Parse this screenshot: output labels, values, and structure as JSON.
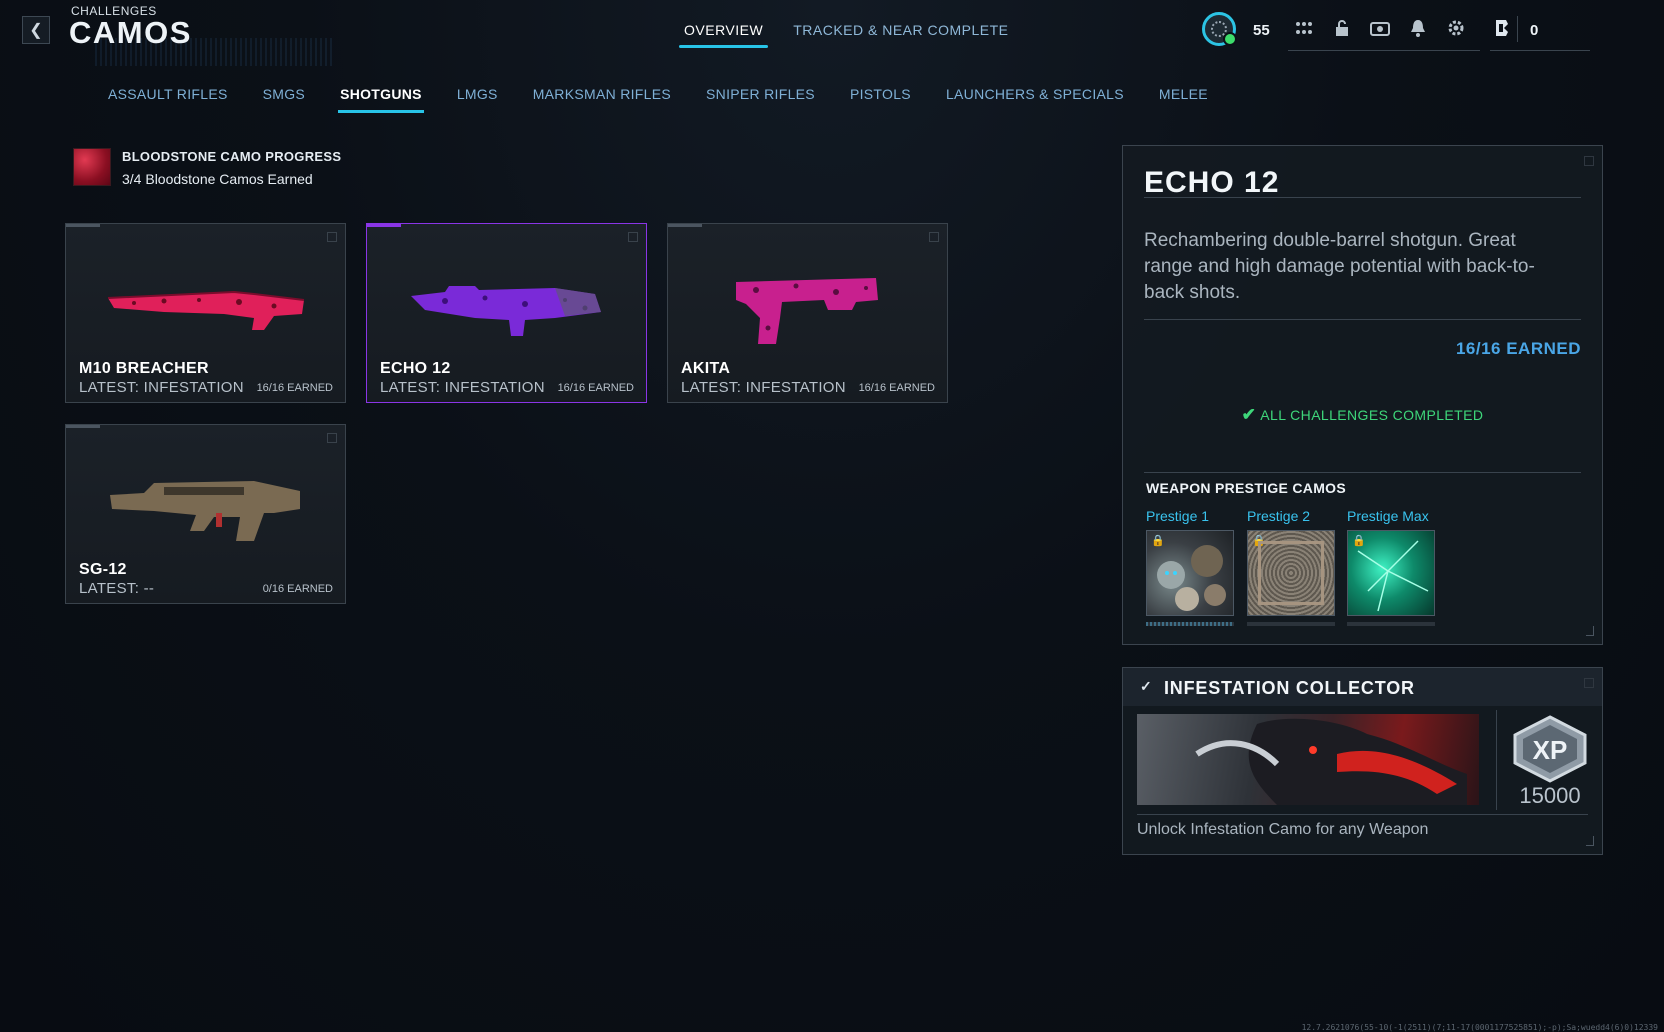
{
  "header": {
    "breadcrumb": "CHALLENGES",
    "title": "CAMOS",
    "back_icon": "chevron-left-icon"
  },
  "top_tabs": [
    {
      "label": "OVERVIEW",
      "active": true
    },
    {
      "label": "TRACKED & NEAR COMPLETE",
      "active": false
    }
  ],
  "hud": {
    "level": "55",
    "currency": "0",
    "icons": [
      "grid-menu-icon",
      "unlock-icon",
      "camera-icon",
      "bell-icon",
      "gear-icon"
    ],
    "accent": "#28c4e8"
  },
  "category_tabs": [
    {
      "label": "ASSAULT RIFLES",
      "active": false
    },
    {
      "label": "SMGS",
      "active": false
    },
    {
      "label": "SHOTGUNS",
      "active": true
    },
    {
      "label": "LMGS",
      "active": false
    },
    {
      "label": "MARKSMAN RIFLES",
      "active": false
    },
    {
      "label": "SNIPER RIFLES",
      "active": false
    },
    {
      "label": "PISTOLS",
      "active": false
    },
    {
      "label": "LAUNCHERS & SPECIALS",
      "active": false
    },
    {
      "label": "MELEE",
      "active": false
    }
  ],
  "progress": {
    "title": "BLOODSTONE CAMO PROGRESS",
    "count": "3/4 Bloodstone Camos Earned"
  },
  "weapons": [
    {
      "name": "M10 BREACHER",
      "latest": "LATEST: INFESTATION",
      "earned": "16/16 EARNED",
      "camo_color": "#e0205a",
      "selected": false
    },
    {
      "name": "ECHO 12",
      "latest": "LATEST: INFESTATION",
      "earned": "16/16 EARNED",
      "camo_color": "#7a2ad8",
      "selected": true
    },
    {
      "name": "AKITA",
      "latest": "LATEST: INFESTATION",
      "earned": "16/16 EARNED",
      "camo_color": "#c8208e",
      "selected": false
    },
    {
      "name": "SG-12",
      "latest": "LATEST: --",
      "earned": "0/16 EARNED",
      "camo_color": "#7a6a52",
      "selected": false
    }
  ],
  "detail": {
    "title": "ECHO 12",
    "description": "Rechambering double-barrel shotgun. Great range and high damage potential with back-to-back shots.",
    "earned": "16/16 EARNED",
    "status": "ALL CHALLENGES COMPLETED",
    "prestige_heading": "WEAPON PRESTIGE CAMOS",
    "prestige": [
      {
        "label": "Prestige 1",
        "locked": true
      },
      {
        "label": "Prestige 2",
        "locked": true
      },
      {
        "label": "Prestige Max",
        "locked": true
      }
    ]
  },
  "collector": {
    "title": "INFESTATION COLLECTOR",
    "xp_label": "XP",
    "xp": "15000",
    "description": "Unlock Infestation Camo for any Weapon"
  },
  "footer": "12.7.2621076(55-10(-1(2511)(7;11-17(0001177525851);-p);Sa;wuedd4(6)0)12339"
}
